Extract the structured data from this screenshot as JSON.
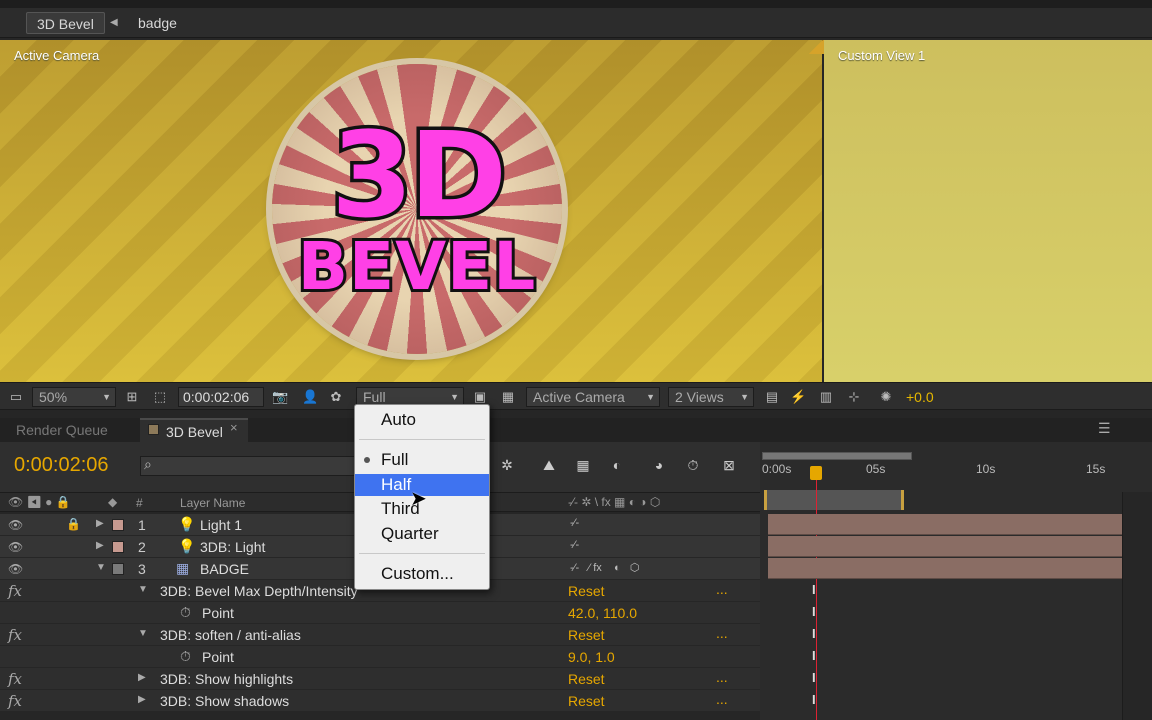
{
  "breadcrumb": {
    "comp": "3D Bevel",
    "layer": "badge"
  },
  "viewer": {
    "left_label": "Active Camera",
    "right_label": "Custom View 1",
    "badge_title": "3D",
    "badge_subtitle": "BEVEL"
  },
  "viewer_toolbar": {
    "zoom": "50%",
    "timecode": "0:00:02:06",
    "resolution": "Full",
    "camera": "Active Camera",
    "views": "2 Views",
    "exposure": "+0.0"
  },
  "panel_tabs": {
    "render_queue": "Render Queue",
    "comp": "3D Bevel"
  },
  "timeline": {
    "current_time": "0:00:02:06",
    "columns": {
      "hash": "#",
      "layer_name": "Layer Name"
    },
    "ruler": [
      "0:00s",
      "05s",
      "10s",
      "15s"
    ],
    "layers": [
      {
        "num": "1",
        "name": "Light 1"
      },
      {
        "num": "2",
        "name": "3DB: Light"
      },
      {
        "num": "3",
        "name": "BADGE"
      }
    ],
    "properties": [
      {
        "name": "3DB: Bevel Max Depth/Intensity",
        "value": "Reset",
        "dots": "..."
      },
      {
        "name": "Point",
        "value": "42.0, 110.0"
      },
      {
        "name": "3DB: soften / anti-alias",
        "value": "Reset",
        "dots": "..."
      },
      {
        "name": "Point",
        "value": "9.0, 1.0"
      },
      {
        "name": "3DB: Show highlights",
        "value": "Reset",
        "dots": "..."
      },
      {
        "name": "3DB: Show shadows",
        "value": "Reset",
        "dots": "..."
      }
    ]
  },
  "resolution_menu": {
    "items": [
      "Auto",
      "Full",
      "Half",
      "Third",
      "Quarter",
      "Custom..."
    ],
    "selected": "Half",
    "checked": "Full"
  }
}
